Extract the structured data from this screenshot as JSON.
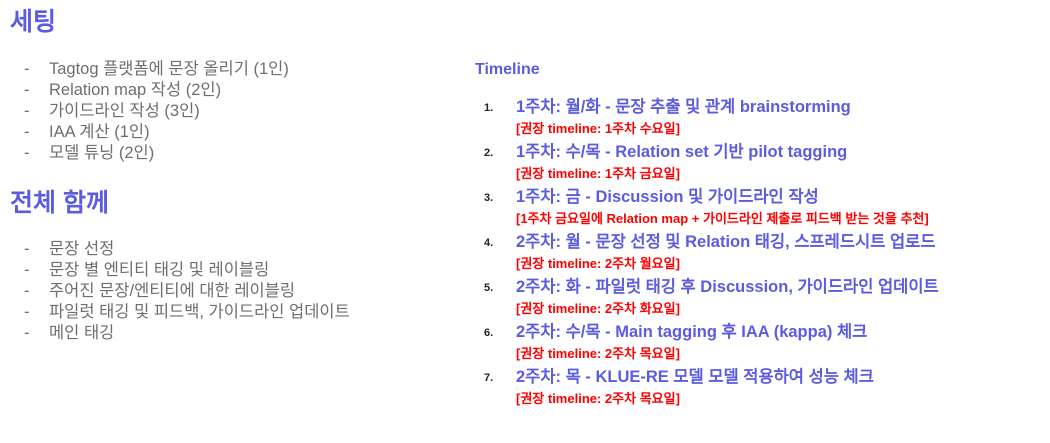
{
  "sections": {
    "settings": {
      "heading": "세팅",
      "items": [
        "Tagtog 플랫폼에 문장 올리기 (1인)",
        "Relation map 작성 (2인)",
        "가이드라인 작성 (3인)",
        "IAA 계산 (1인)",
        "모델 튜닝 (2인)"
      ]
    },
    "together": {
      "heading": "전체 함께",
      "items": [
        "문장 선정",
        "문장 별 엔티티 태깅 및 레이블링",
        "주어진 문장/엔티티에 대한 레이블링",
        "파일럿 태깅 및 피드백, 가이드라인 업데이트",
        "메인 태깅"
      ]
    }
  },
  "timeline": {
    "title": "Timeline",
    "items": [
      {
        "number": "1.",
        "main": "1주차: 월/화 - 문장 추출 및 관계 brainstorming",
        "sub": "[권장 timeline: 1주차 수요일]"
      },
      {
        "number": "2.",
        "main": "1주차: 수/목 - Relation set 기반 pilot tagging",
        "sub": "[권장 timeline: 1주차 금요일]"
      },
      {
        "number": "3.",
        "main": "1주차: 금 - Discussion 및 가이드라인 작성",
        "sub": "[1주차 금요일에 Relation map + 가이드라인 제출로 피드백 받는 것을 추천]"
      },
      {
        "number": "4.",
        "main": "2주차: 월 - 문장 선정 및 Relation 태깅, 스프레드시트 업로드",
        "sub": "[권장 timeline: 2주차 월요일]"
      },
      {
        "number": "5.",
        "main": "2주차: 화 - 파일럿 태깅 후 Discussion, 가이드라인 업데이트",
        "sub": "[권장 timeline: 2주차 화요일]"
      },
      {
        "number": "6.",
        "main": "2주차: 수/목 - Main tagging 후 IAA (kappa) 체크",
        "sub": "[권장 timeline: 2주차 목요일]"
      },
      {
        "number": "7.",
        "main": "2주차: 목 - KLUE-RE 모델 모델 적용하여 성능 체크",
        "sub": "[권장 timeline: 2주차 목요일]"
      }
    ]
  },
  "bullet_symbol": "-",
  "colors": {
    "heading": "#5b5ce0",
    "body_text": "#6e6e6e",
    "timeline_main": "#5b5ce0",
    "timeline_sub": "#ff0000"
  }
}
